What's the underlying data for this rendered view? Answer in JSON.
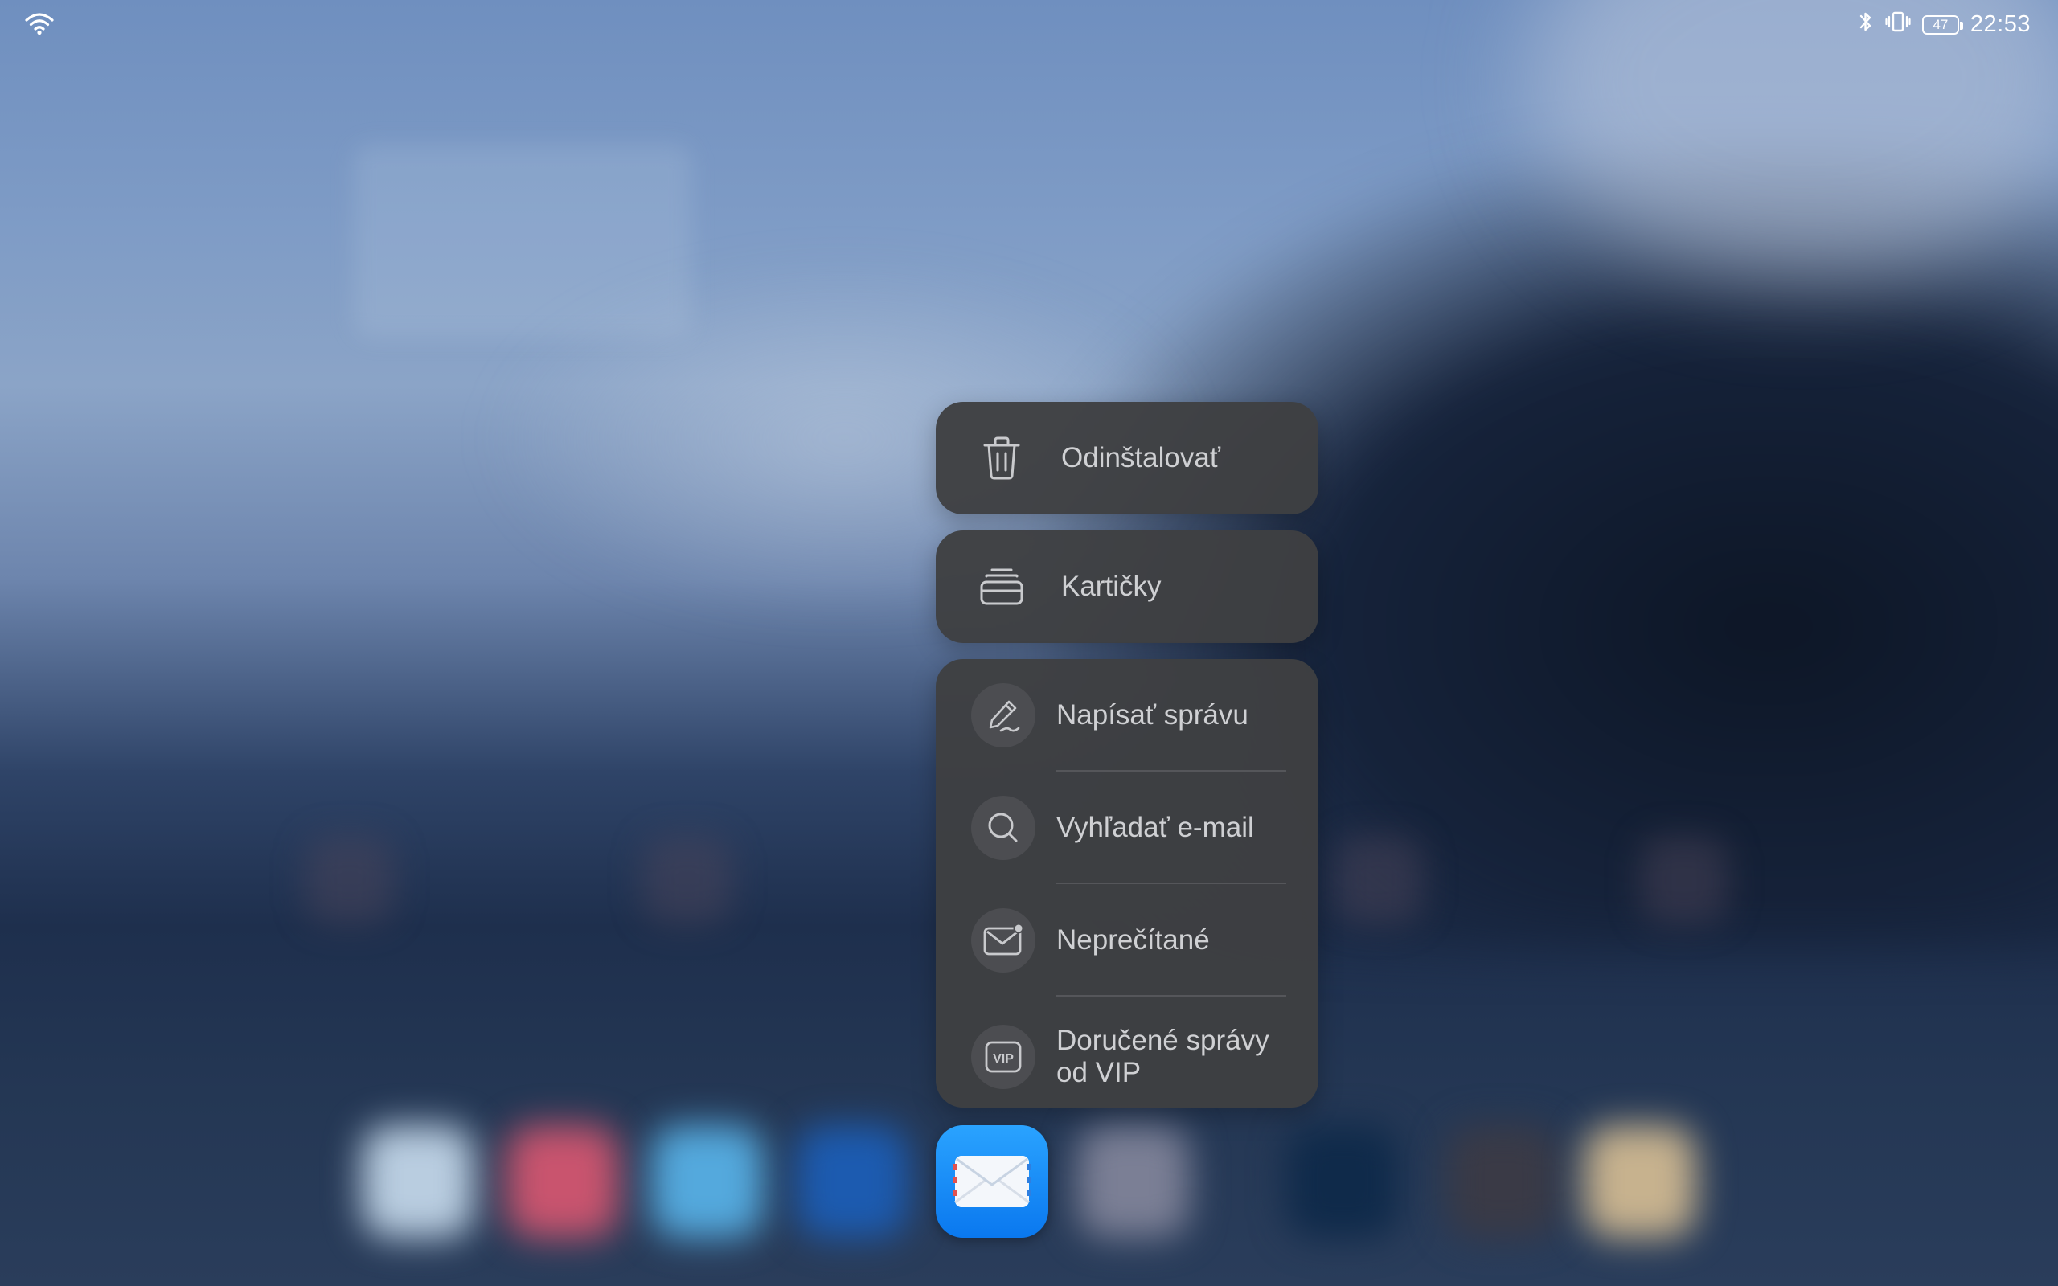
{
  "status_bar": {
    "time": "22:53",
    "battery_percent": "47",
    "icons": [
      "wifi-icon",
      "bluetooth-icon",
      "vibrate-icon",
      "battery-icon"
    ]
  },
  "menu": {
    "uninstall_label": "Odinštalovať",
    "cards_label": "Kartičky",
    "shortcuts": [
      {
        "label": "Napísať správu",
        "icon": "pen-icon"
      },
      {
        "label": "Vyhľadať e-mail",
        "icon": "search-icon"
      },
      {
        "label": "Neprečítané",
        "icon": "unread-mail-icon"
      },
      {
        "label_line1": "Doručené správy",
        "label_line2": "od VIP",
        "icon": "vip-icon"
      }
    ]
  },
  "app": {
    "icon": "mail-app-icon",
    "color": "#1a8cff"
  }
}
